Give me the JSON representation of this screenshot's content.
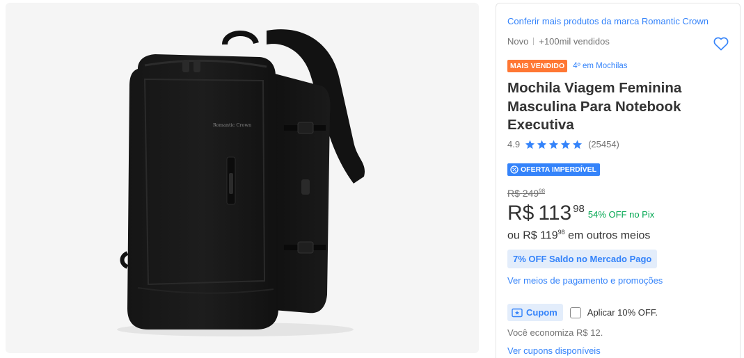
{
  "product_image": {
    "alt": "Mochila Viagem Feminina Masculina Para Notebook Executiva",
    "bag_label": "Romantic Crown"
  },
  "card": {
    "brand_link": "Conferir mais produtos da marca Romantic Crown",
    "condition": "Novo",
    "sold": "+100mil vendidos",
    "favorite_icon": "heart-outline-icon",
    "badge_best_seller": "MAIS VENDIDO",
    "rank_link": "4º em Mochilas",
    "title": "Mochila Viagem Feminina Masculina Para Notebook Executiva",
    "rating_score": "4.9",
    "rating_stars": 5,
    "rating_count": "(25454)",
    "deal_badge": "OFERTA IMPERDÍVEL",
    "old_price_currency": "R$",
    "old_price_int": "249",
    "old_price_cents": "98",
    "price_currency": "R$",
    "price_int": "113",
    "price_cents": "98",
    "pix_discount": "54% OFF no Pix",
    "installments_prefix": "ou R$",
    "installments_int": "119",
    "installments_cents": "98",
    "installments_suffix": "em outros meios",
    "saldo_tag": "7% OFF Saldo no Mercado Pago",
    "payments_link": "Ver meios de pagamento e promoções",
    "coupon_tag": "Cupom",
    "coupon_apply_label": "Aplicar 10% OFF.",
    "coupon_checked": false,
    "savings_text": "Você economiza R$ 12.",
    "coupons_link": "Ver cupons disponíveis"
  },
  "colors": {
    "accent_blue": "#3483fa",
    "best_seller_orange": "#ff7733",
    "pix_green": "#00a650",
    "light_blue_bg": "#e3edfb"
  }
}
